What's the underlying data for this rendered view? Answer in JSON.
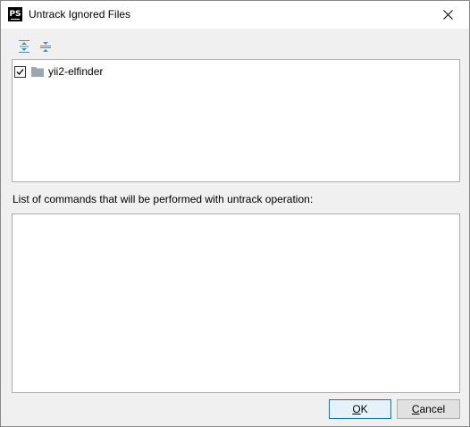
{
  "window": {
    "title": "Untrack Ignored Files",
    "app_icon_text": "PS"
  },
  "toolbar": {
    "expand_all_icon": "expand-all-icon",
    "collapse_all_icon": "collapse-all-icon"
  },
  "tree": {
    "items": [
      {
        "label": "yii2-elfinder",
        "checked": true,
        "icon": "folder-icon"
      }
    ]
  },
  "commands": {
    "label": "List of commands that will be performed with untrack operation:",
    "content": ""
  },
  "buttons": {
    "ok": {
      "mnemonic": "O",
      "rest": "K"
    },
    "cancel": {
      "mnemonic": "C",
      "rest": "ancel"
    }
  },
  "colors": {
    "accent": "#0078d7",
    "folder": "#9aa7b0",
    "toolbar_icon": "#3d8fc9"
  }
}
